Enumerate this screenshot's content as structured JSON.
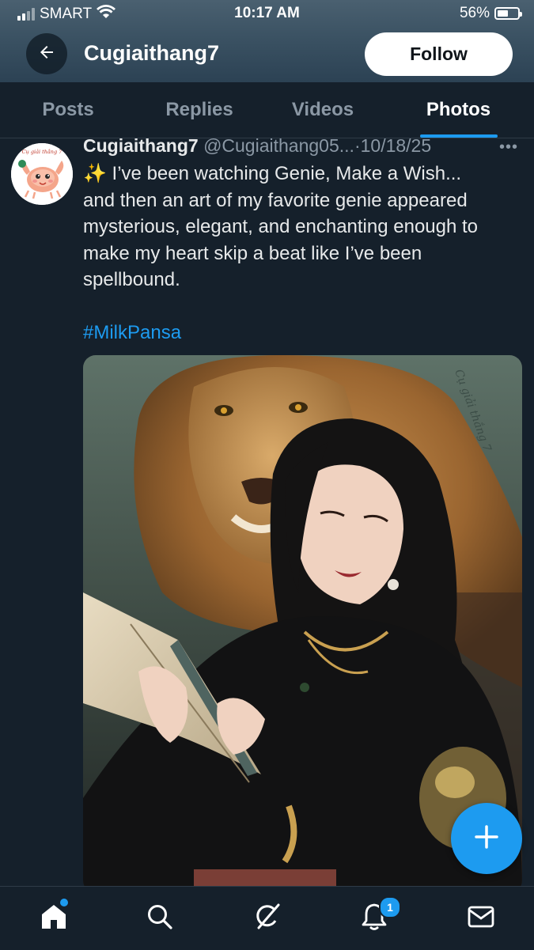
{
  "status_bar": {
    "carrier": "SMART",
    "time": "10:17 AM",
    "battery": "56%",
    "battery_level": 0.56,
    "signal_bars": 4,
    "signal_bars_filled": 2
  },
  "header": {
    "title": "Cugiaithang7",
    "follow_label": "Follow",
    "back_icon": "arrow-left-icon"
  },
  "tabs": [
    {
      "label": "Posts",
      "active": false
    },
    {
      "label": "Replies",
      "active": false
    },
    {
      "label": "Videos",
      "active": false
    },
    {
      "label": "Photos",
      "active": true
    }
  ],
  "tweet": {
    "author": "Cugiaithang7",
    "handle": "@Cugiaithang05...",
    "separator": "·",
    "date": "10/18/25",
    "more_icon": "more-icon",
    "avatar_text": "Cụ giải thắng 7",
    "text_lines": [
      "✨ I’ve been watching Genie, Make a Wish...",
      "and then an art of my favorite genie appeared",
      "mysterious, elegant, and enchanting enough to",
      "make my heart skip a beat like I’ve been",
      "spellbound."
    ],
    "hashtag": "#MilkPansa",
    "media_watermark": "Cụ giải thắng 7"
  },
  "fab": {
    "icon": "plus-icon"
  },
  "bottom_nav": {
    "items": [
      "home-icon",
      "search-icon",
      "grok-icon",
      "notifications-icon",
      "messages-icon"
    ],
    "notification_badge": "1"
  },
  "colors": {
    "background": "#15202b",
    "accent": "#1d9bf0",
    "muted_text": "#8b98a5",
    "primary_text": "#e7e9ea"
  }
}
